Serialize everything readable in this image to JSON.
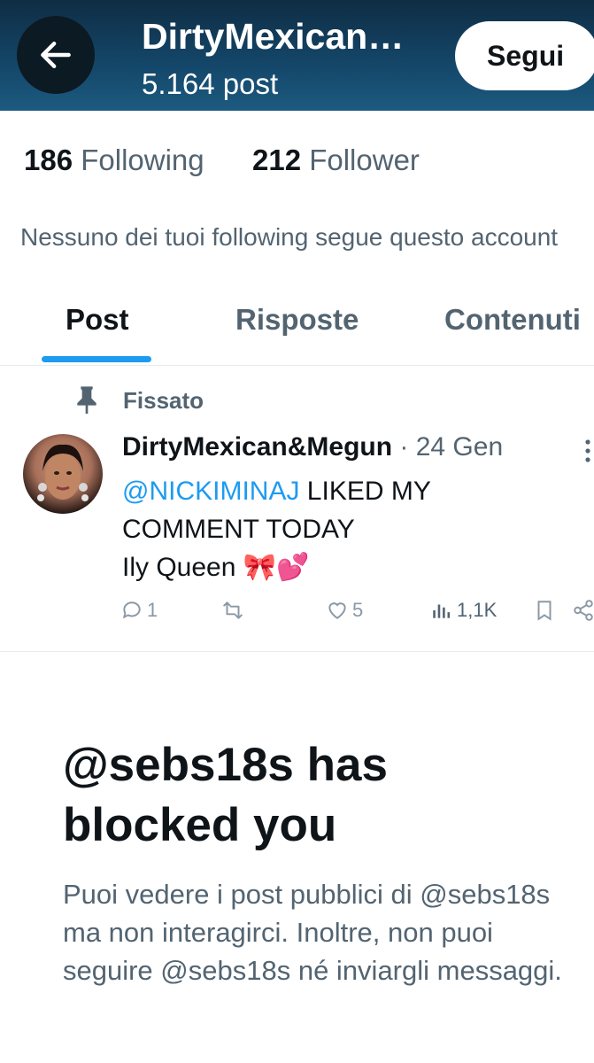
{
  "header": {
    "name": "DirtyMexican…",
    "post_count": "5.164 post",
    "follow_label": "Segui"
  },
  "stats": {
    "following_count": "186",
    "following_label": "Following",
    "followers_count": "212",
    "followers_label": "Follower"
  },
  "mutual_text": "Nessuno dei tuoi following segue questo account",
  "tabs": [
    {
      "label": "Post",
      "active": true
    },
    {
      "label": "Risposte",
      "active": false
    },
    {
      "label": "Contenuti",
      "active": false
    }
  ],
  "pinned_tweet": {
    "pinned_label": "Fissato",
    "author": "DirtyMexican&Megun",
    "date": " · 24 Gen",
    "mention": "@NICKIMINAJ",
    "text_line1_rest": " LIKED MY",
    "text_line2": "COMMENT TODAY",
    "text_line3": "Ily Queen 🎀💕",
    "replies": "1",
    "retweets": "",
    "likes": "5",
    "views": "1,1K"
  },
  "blocked": {
    "title": "@sebs18s has blocked you",
    "description": "Puoi vedere i post pubblici di @sebs18s ma non interagirci. Inoltre, non puoi seguire @sebs18s né inviargli messaggi."
  },
  "colors": {
    "accent": "#1d9bf0",
    "header_bg": "#14476a",
    "secondary_text": "#536471"
  }
}
